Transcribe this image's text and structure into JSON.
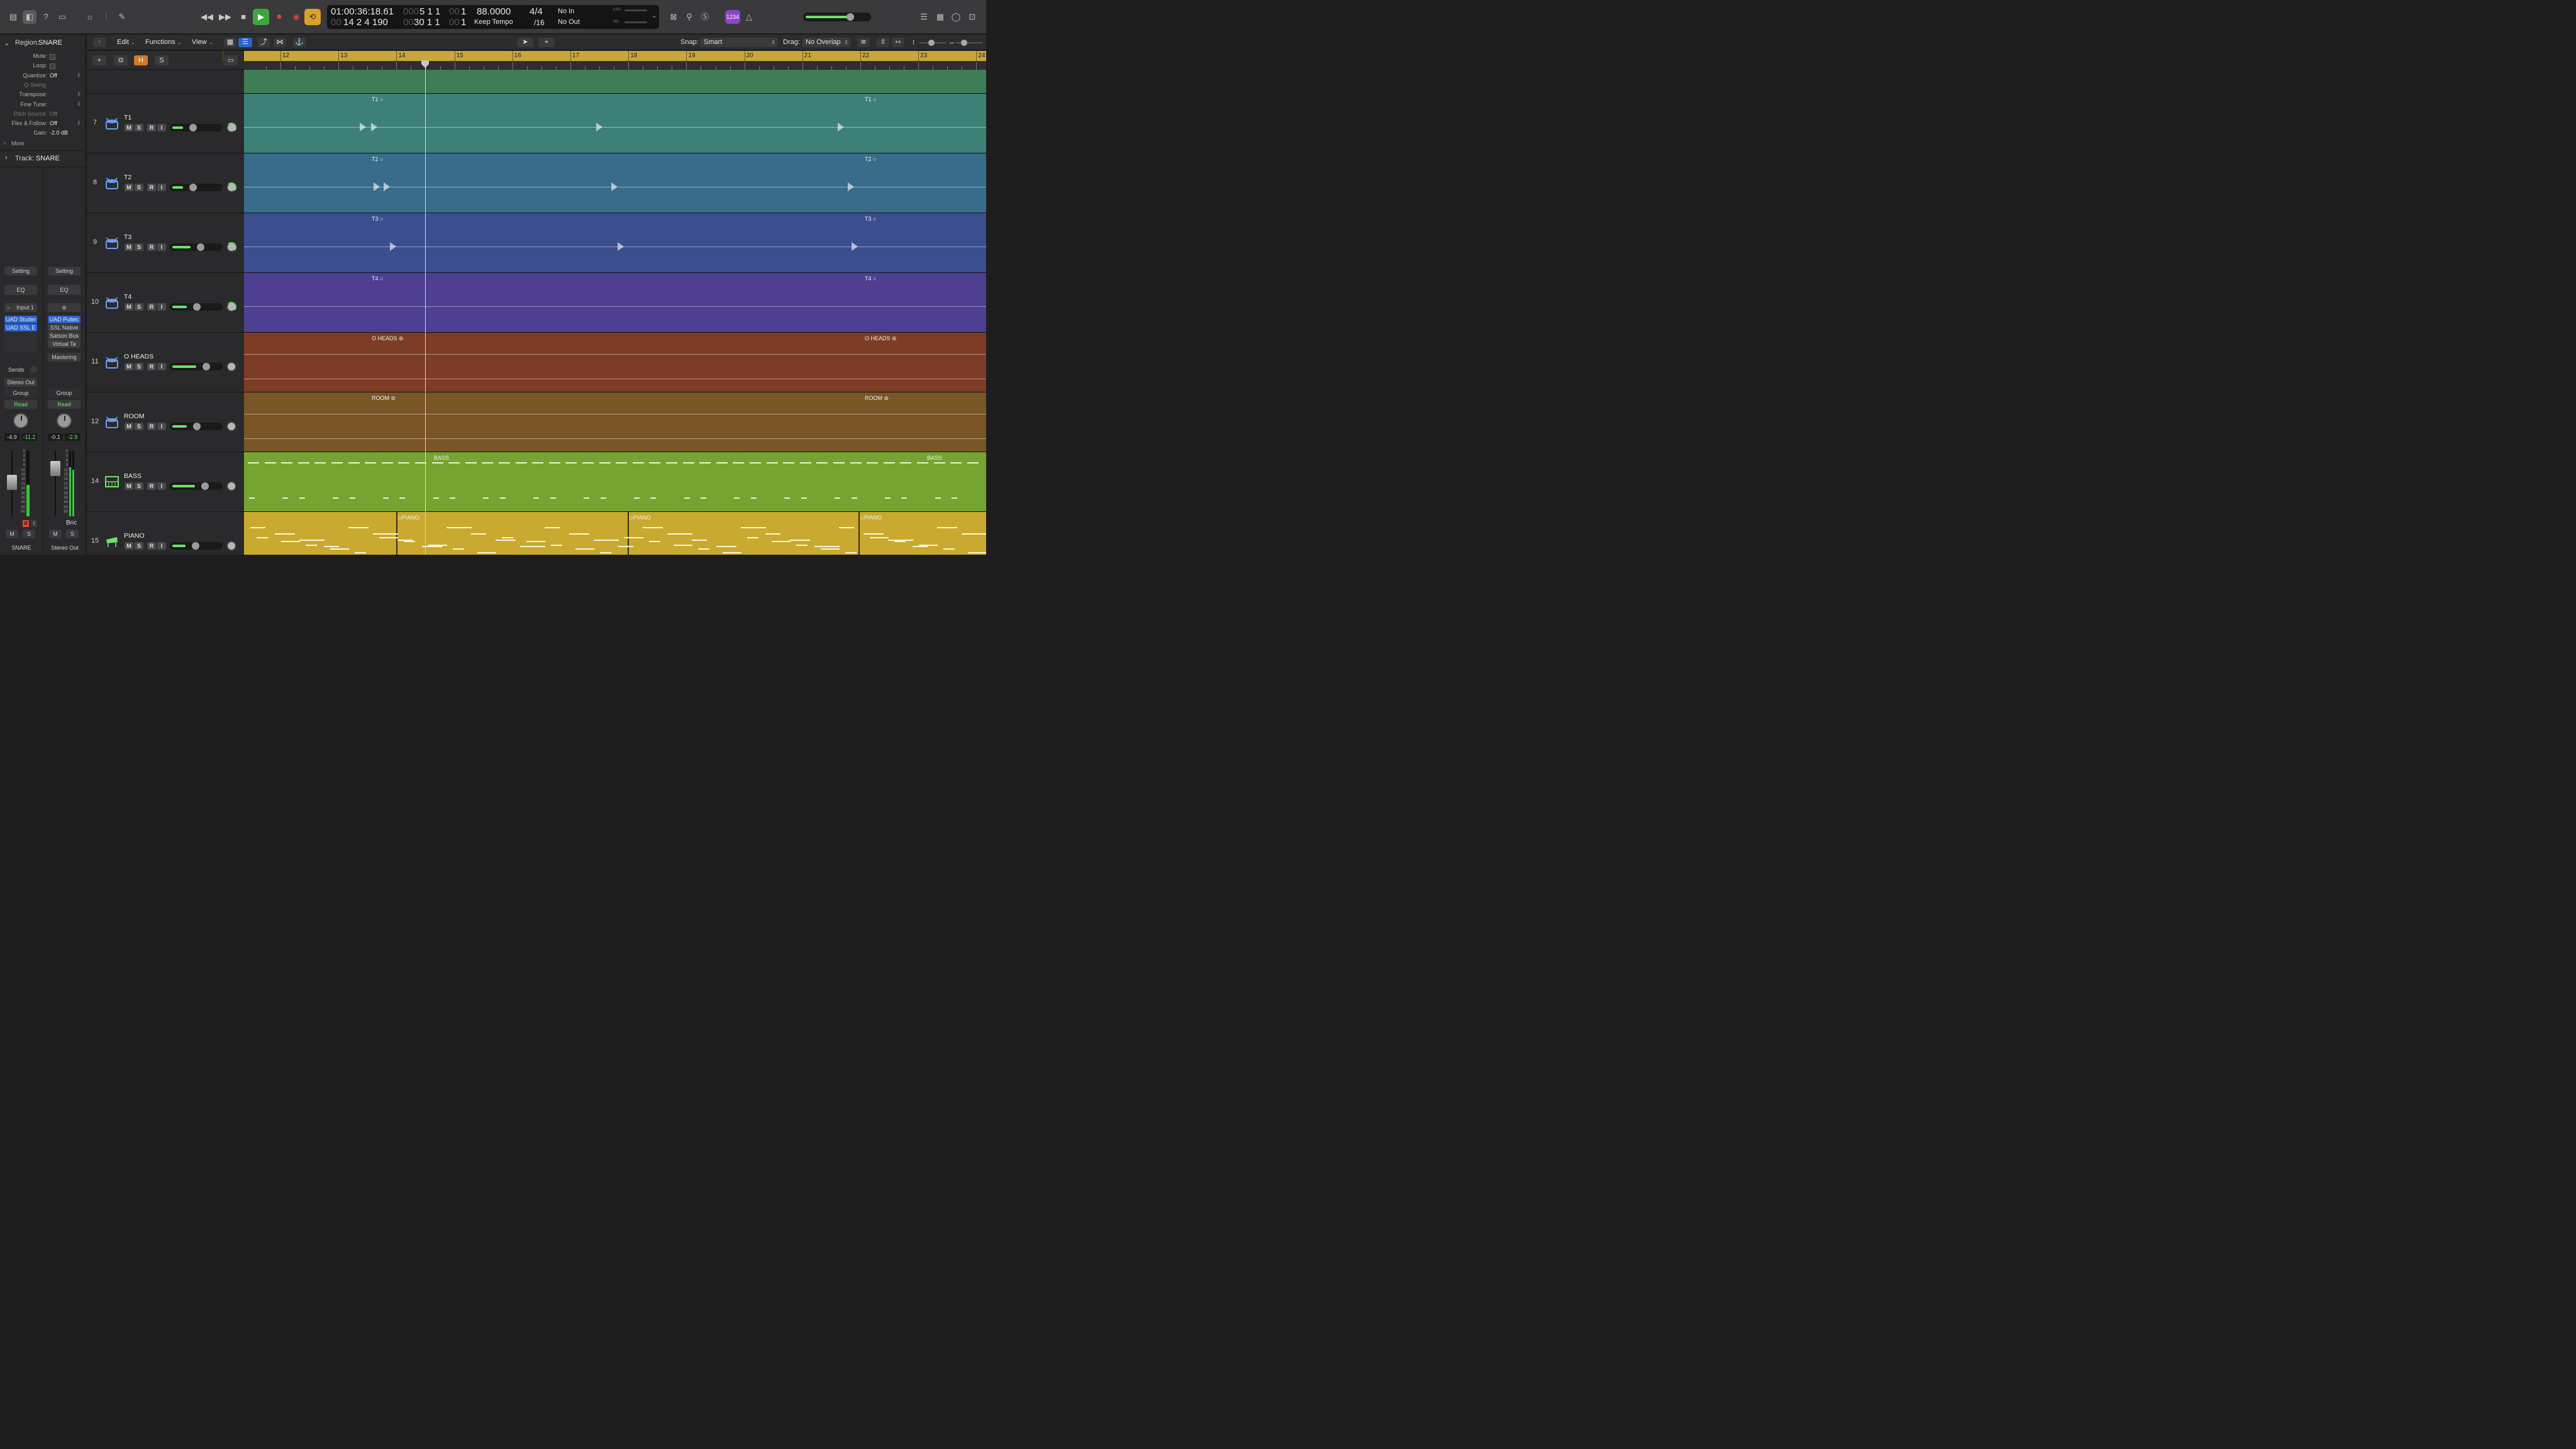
{
  "control_bar": {
    "transport": {
      "rewind_icon": "rewind-icon",
      "forward_icon": "fast-forward-icon",
      "stop_icon": "stop-icon",
      "play_icon": "play-icon",
      "record_icon": "record-icon",
      "capture_icon": "capture-record-icon",
      "cycle_icon": "cycle-icon"
    },
    "lcd": {
      "smpte": "01:00:36:18.61",
      "smpte_sub": "14 2 4 190",
      "bars_main_dim": "000",
      "bars_main": "5 1 1",
      "bars_main_tail_dim": "00",
      "bars_main_tail": "1",
      "bars_sub_dim": "00",
      "bars_sub": "30 1 1",
      "bars_sub_tail_dim": "00",
      "bars_sub_tail": "1",
      "tempo": "88.0000",
      "tempo_mode": "Keep Tempo",
      "signature": "4/4",
      "division": "/16",
      "in": "No In",
      "out": "No Out",
      "cpu_label": "CPU",
      "hd_label": "HD"
    },
    "count_in_badge": "1234",
    "master_volume": 0.75
  },
  "inspector": {
    "region_label": "Region:",
    "region_name": "SNARE",
    "rows": [
      {
        "label": "Mute:",
        "value": "",
        "checkbox": true
      },
      {
        "label": "Loop:",
        "value": "",
        "checkbox": true
      },
      {
        "label": "Quantize:",
        "value": "Off"
      },
      {
        "label": "Q-Swing:",
        "value": "",
        "dim": true
      },
      {
        "label": "Transpose:",
        "value": ""
      },
      {
        "label": "Fine Tune:",
        "value": ""
      },
      {
        "label": "Pitch Source:",
        "value": "Off",
        "dim": true
      },
      {
        "label": "Flex & Follow:",
        "value": "Off"
      },
      {
        "label": "Gain:",
        "value": "-2.0 dB"
      }
    ],
    "more_label": "More",
    "track_label": "Track:",
    "track_name": "SNARE",
    "strip1": {
      "setting": "Setting",
      "eq": "EQ",
      "input": "Input 1",
      "plugins": [
        "UAD Studer",
        "UAD SSL E"
      ],
      "sends": "Sends",
      "output": "Stereo Out",
      "group": "Group",
      "automation": "Read",
      "pan_value": "-4.9",
      "peak": "-11.2",
      "m": "M",
      "s": "S",
      "r": "R",
      "i": "I",
      "name": "SNARE"
    },
    "strip2": {
      "setting": "Setting",
      "eq": "EQ",
      "plugins": [
        "UAD Pultec",
        "SSL Native",
        "Satson Bus",
        "Virtual Ta"
      ],
      "mastering": "Mastering",
      "group": "Group",
      "automation": "Read",
      "pan_value": "-0.1",
      "peak": "-2.9",
      "bnc": "Bnc",
      "m": "M",
      "s": "S",
      "name": "Stereo Out"
    },
    "meter_scale": [
      "0",
      "3",
      "6",
      "9",
      "12",
      "15",
      "18",
      "21",
      "24",
      "30",
      "35",
      "40",
      "50",
      "60"
    ]
  },
  "tracks_toolbar": {
    "edit": "Edit",
    "functions": "Functions",
    "view": "View",
    "snap_label": "Snap:",
    "snap_value": "Smart",
    "drag_label": "Drag:",
    "drag_value": "No Overlap"
  },
  "tracklist_header": {
    "add": "+",
    "h": "H",
    "s": "S"
  },
  "ruler": {
    "bars": [
      "12",
      "13",
      "14",
      "15",
      "16",
      "17",
      "18",
      "19",
      "20",
      "21",
      "22",
      "23",
      "24"
    ]
  },
  "tracks": [
    {
      "num": "7",
      "name": "T1",
      "region": "T1",
      "color": "#3d8078",
      "fader": 0.22
    },
    {
      "num": "8",
      "name": "T2",
      "region": "T2",
      "color": "#386c8a",
      "fader": 0.22
    },
    {
      "num": "9",
      "name": "T3",
      "region": "T3",
      "color": "#3b4f8f",
      "fader": 0.38
    },
    {
      "num": "10",
      "name": "T4",
      "region": "T4",
      "color": "#4e3f93",
      "fader": 0.3
    },
    {
      "num": "11",
      "name": "O HEADS",
      "region": "O HEADS",
      "color": "#7c3c25",
      "fader": 0.5
    },
    {
      "num": "12",
      "name": "ROOM",
      "region": "ROOM",
      "color": "#7a5526",
      "fader": 0.3
    },
    {
      "num": "14",
      "name": "BASS",
      "region": "BASS",
      "color": "#76a431",
      "fader": 0.48
    },
    {
      "num": "15",
      "name": "PIANO",
      "region": "PIANO",
      "color": "#c9a92f",
      "fader": 0.28
    }
  ],
  "buttons": {
    "m": "M",
    "s": "S",
    "r": "R",
    "i": "I"
  }
}
